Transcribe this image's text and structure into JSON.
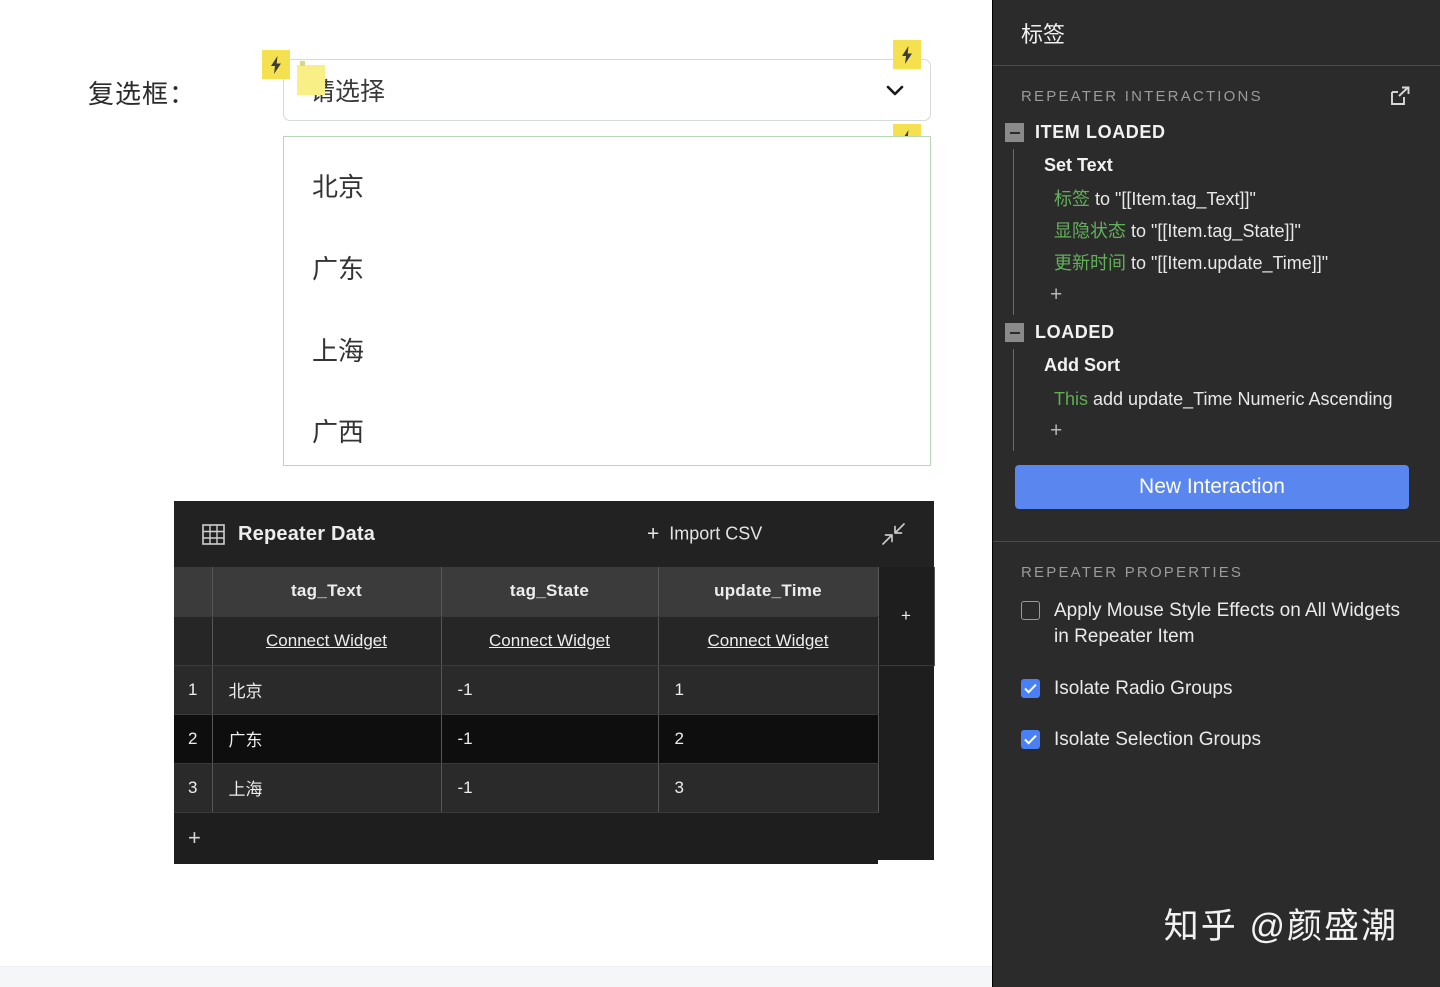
{
  "canvas": {
    "field_label": "复选框：",
    "select": {
      "value": "请选择",
      "chevron_icon": "chevron-down-icon"
    },
    "bolt_icon": "lightning-bolt-icon",
    "repeater_items": [
      "北京",
      "广东",
      "上海",
      "广西"
    ],
    "colors": {
      "repeater_outline": "#b9d9b4",
      "bolt_badge": "#f5e14f",
      "text_highlight": "#f8ef86"
    }
  },
  "repeater_data": {
    "grid_icon": "table-grid-icon",
    "title": "Repeater Data",
    "import_label": "Import CSV",
    "import_plus": "+",
    "collapse_icon": "collapse-arrows-icon",
    "columns": [
      "tag_Text",
      "tag_State",
      "update_Time"
    ],
    "connect_label": "Connect Widget",
    "add_column_label": "+",
    "add_row_label": "+",
    "rows": [
      {
        "index": "1",
        "tag_Text": "北京",
        "tag_State": "-1",
        "update_Time": "1"
      },
      {
        "index": "2",
        "tag_Text": "广东",
        "tag_State": "-1",
        "update_Time": "2"
      },
      {
        "index": "3",
        "tag_Text": "上海",
        "tag_State": "-1",
        "update_Time": "3"
      }
    ]
  },
  "panel": {
    "title": "标签",
    "interactions": {
      "section_label": "REPEATER INTERACTIONS",
      "expand_icon": "open-external-icon",
      "events": [
        {
          "name": "ITEM LOADED",
          "toggle_icon": "collapse-minus-icon",
          "action": "Set Text",
          "lines": [
            {
              "target": "标签",
              "rest": " to \"[[Item.tag_Text]]\""
            },
            {
              "target": "显隐状态",
              "rest": " to \"[[Item.tag_State]]\""
            },
            {
              "target": "更新时间",
              "rest": " to \"[[Item.update_Time]]\""
            }
          ],
          "add_label": "+"
        },
        {
          "name": "LOADED",
          "toggle_icon": "collapse-minus-icon",
          "action": "Add Sort",
          "lines": [
            {
              "target": "This",
              "rest": " add update_Time Numeric Ascending"
            }
          ],
          "add_label": "+"
        }
      ],
      "new_interaction_label": "New Interaction"
    },
    "properties": {
      "section_label": "REPEATER PROPERTIES",
      "items": [
        {
          "label": "Apply Mouse Style Effects on All Widgets in Repeater Item",
          "checked": false
        },
        {
          "label": "Isolate Radio Groups",
          "checked": true
        },
        {
          "label": "Isolate Selection Groups",
          "checked": true
        }
      ]
    },
    "accent_color": "#5a86f0",
    "highlight_color": "#63b05a"
  },
  "watermark": "知乎 @颜盛潮"
}
